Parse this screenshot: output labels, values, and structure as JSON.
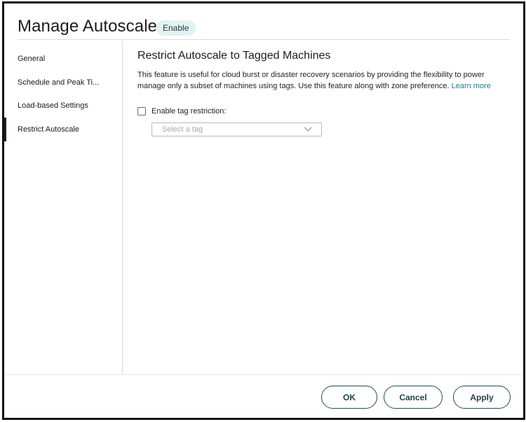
{
  "header": {
    "title": "Manage Autoscale",
    "badge": "Enable"
  },
  "sidebar": {
    "items": [
      {
        "label": "General"
      },
      {
        "label": "Schedule and Peak Ti..."
      },
      {
        "label": "Load-based Settings"
      },
      {
        "label": "Restrict Autoscale"
      }
    ],
    "active_index": 3
  },
  "main": {
    "title": "Restrict Autoscale to Tagged Machines",
    "description": "This feature is useful for cloud burst or disaster recovery scenarios by providing the flexibility to power manage only a subset of machines using tags. Use this feature along with zone preference.",
    "learn_more": "Learn more",
    "checkbox_label": "Enable tag restriction:",
    "checkbox_checked": false,
    "select_placeholder": "Select a tag"
  },
  "footer": {
    "ok_label": "OK",
    "cancel_label": "Cancel",
    "apply_label": "Apply"
  },
  "colors": {
    "accent": "#1b7f8c",
    "button_border": "#1f4f5a",
    "badge_bg": "#e3f2f2"
  },
  "icons": {
    "select_chevron": "chevron-down-icon"
  }
}
